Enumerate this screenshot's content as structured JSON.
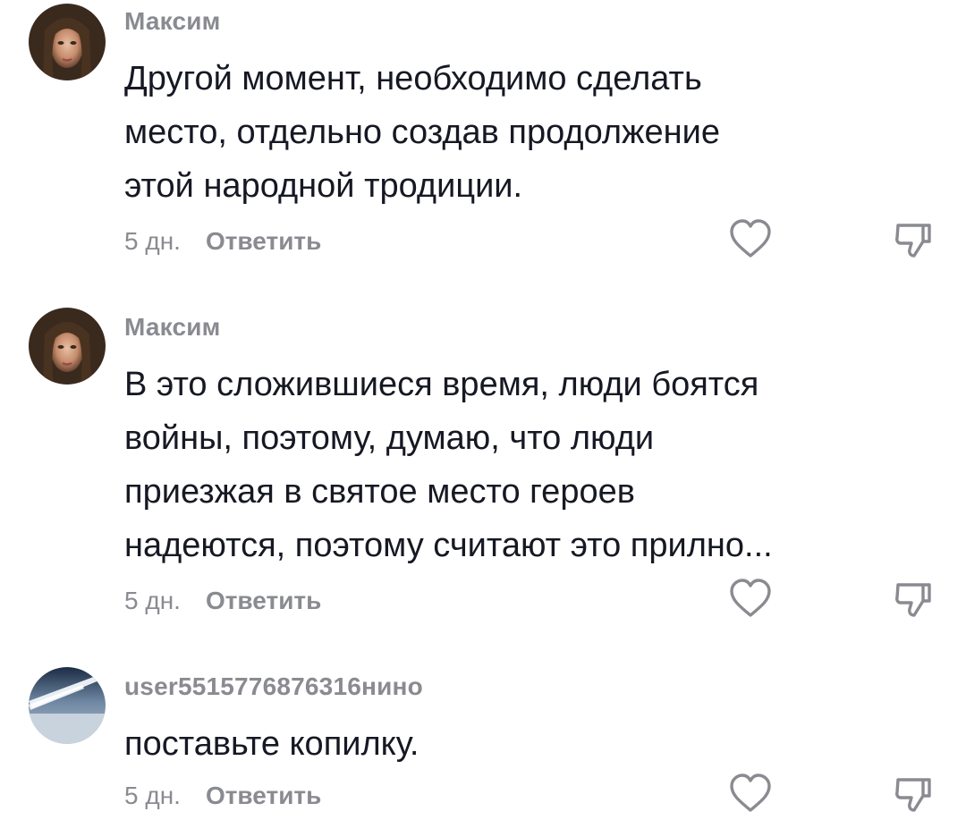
{
  "comments": [
    {
      "author": "Максим",
      "avatar": "woman-portrait-avatar",
      "lines": [
        "Другой момент, необходимо сделать",
        "место, отдельно создав продолжение",
        "этой народной тродиции."
      ],
      "time": "5 дн.",
      "reply": "Ответить"
    },
    {
      "author": "Максим",
      "avatar": "woman-portrait-avatar",
      "lines": [
        "В это сложившиеся время, люди боятся",
        "войны, поэтому, думаю, что люди",
        "приезжая в святое место героев",
        "надеются, поэтому считают это прилно..."
      ],
      "time": "5 дн.",
      "reply": "Ответить"
    },
    {
      "author": "user5515776876316нино",
      "avatar": "airplane-wing-sky-avatar",
      "lines": [
        "поставьте копилку."
      ],
      "time": "5 дн.",
      "reply": "Ответить"
    }
  ],
  "icons": {
    "like": "heart-outline-icon",
    "dislike": "thumbs-down-icon"
  },
  "colors": {
    "text": "#161823",
    "secondary": "#8a8b91",
    "background": "#ffffff"
  }
}
